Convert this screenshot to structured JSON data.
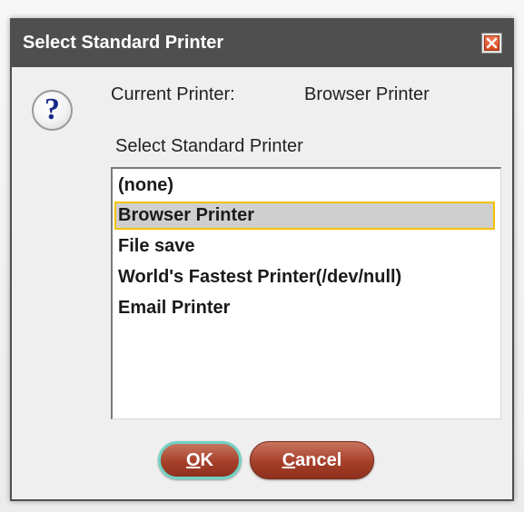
{
  "dialog": {
    "title": "Select Standard Printer",
    "close_icon": "close-icon"
  },
  "info": {
    "icon": "question-icon",
    "question_glyph": "?",
    "current_printer_label": "Current Printer:",
    "current_printer_value": "Browser Printer",
    "select_label": "Select Standard Printer"
  },
  "printers": {
    "items": [
      {
        "label": "(none)",
        "selected": false
      },
      {
        "label": "Browser Printer",
        "selected": true
      },
      {
        "label": "File save",
        "selected": false
      },
      {
        "label": "World's Fastest Printer(/dev/null)",
        "selected": false
      },
      {
        "label": "Email Printer",
        "selected": false
      }
    ]
  },
  "buttons": {
    "ok_mnemonic": "O",
    "ok_rest": "K",
    "cancel_mnemonic": "C",
    "cancel_rest": "ancel"
  },
  "colors": {
    "titlebar": "#4f4f4f",
    "selection_bg": "#cfcfcf",
    "selection_border": "#f3c200",
    "button": "#a6402a",
    "focus_ring": "#6fd2c4"
  }
}
